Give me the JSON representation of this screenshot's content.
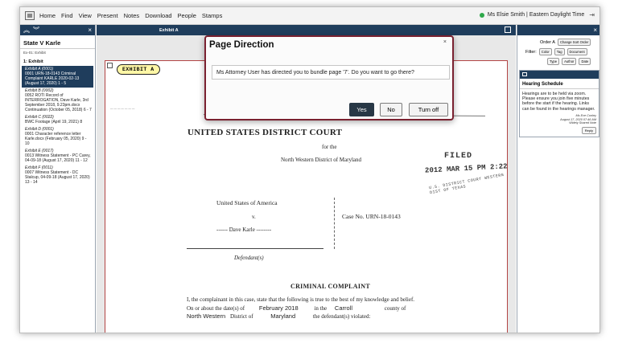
{
  "menu": {
    "items": [
      "Home",
      "Find",
      "View",
      "Present",
      "Notes",
      "Download",
      "People",
      "Stamps"
    ],
    "user": "Ms Elsie Smith | Eastern Daylight Time",
    "status_color": "#2ea84a"
  },
  "left": {
    "nav_up": "≈",
    "nav_down": "≈",
    "close": "×",
    "case_title": "State V Karle",
    "case_sub": "Ex-01: Exhibit",
    "section": "1: Exhibit",
    "exhibits": [
      {
        "head": "Exhibit A (0001)",
        "body": "0001 URN-18-0143 Criminal Complaint KARLE 2020-02-13 (August 17, 2020) 1 - 5",
        "selected": true
      },
      {
        "head": "Exhibit B (0002)",
        "body": "0052 ROTI Record of INTERROGATION, Dave Karle, 3rd September 2018, 9.23pm.docx Continuation (October 05, 2018) 6 - 7",
        "selected": false
      },
      {
        "head": "Exhibit C (0022)",
        "body": "BWC Footage (April 19, 2021) 8",
        "selected": false
      },
      {
        "head": "Exhibit D (0001)",
        "body": "0001 Character reference letter Karle.docx (February 05, 2020) 9 - 10",
        "selected": false
      },
      {
        "head": "Exhibit E (0017)",
        "body": "0013 Witness Statement - PC Carey, 04-09-18 (August 17, 2020) 11 - 12",
        "selected": false
      },
      {
        "head": "Exhibit F (0011)",
        "body": "0007 Witness Statement - DC Stalcup, 04-09-18 (August 17, 2020) 13 - 14",
        "selected": false
      }
    ]
  },
  "center": {
    "tab_label": "Exhibit A",
    "badge": "EXHIBIT A",
    "doc": {
      "court": "UNITED STATES DISTRICT COURT",
      "for_the": "for the",
      "district": "North Western District of Maryland",
      "filed": "FILED",
      "filed_date": "2012 MAR 15 PM 2:22",
      "stamp_text": "U.S. DISTRICT COURT WESTERN DIST OF TEXAS",
      "party": "United States of America",
      "vs": "v.",
      "defendant": "------ Dave Karle --------",
      "case_no": "Case No. URN-18-0143",
      "defendants_label": "Defendant(s)",
      "complaint_title": "CRIMINAL COMPLAINT",
      "para1": "I, the complainant in this case, state that the following is true to the best of my knowledge and belief.",
      "para2_a": "On or about the date(s) of",
      "para2_date": "February 2018",
      "para2_b": "in the",
      "para2_county": "Carroll",
      "para2_c": "county of",
      "para3_a": "North Western",
      "para3_b": "District of",
      "para3_state": "Maryland",
      "para3_c": "the defendant(s) violated:"
    }
  },
  "right": {
    "close": "×",
    "order_label": "Order A",
    "order_button": "Change Sort Order",
    "filter_label": "Filter:",
    "filters_row1": [
      "Color",
      "Tag",
      "Document"
    ],
    "filters_row2": [
      "Type",
      "Author",
      "Date"
    ],
    "note_title": "Hearing Schedule",
    "note_body": "Hearings are to be held via zoom. Please ensure you join five minutes before the start if the hearing. Links can be found in the hearings manager.",
    "note_author": "Ms Eve Conley",
    "note_date": "August 17, 2020 07:46 AM",
    "note_share": "Widely Shared Note",
    "reply": "Reply"
  },
  "modal": {
    "title": "Page Direction",
    "close": "×",
    "message": "Ms Attorney User has directed you to bundle page '7'. Do you want to go there?",
    "yes": "Yes",
    "no": "No",
    "turn_off": "Turn off"
  }
}
